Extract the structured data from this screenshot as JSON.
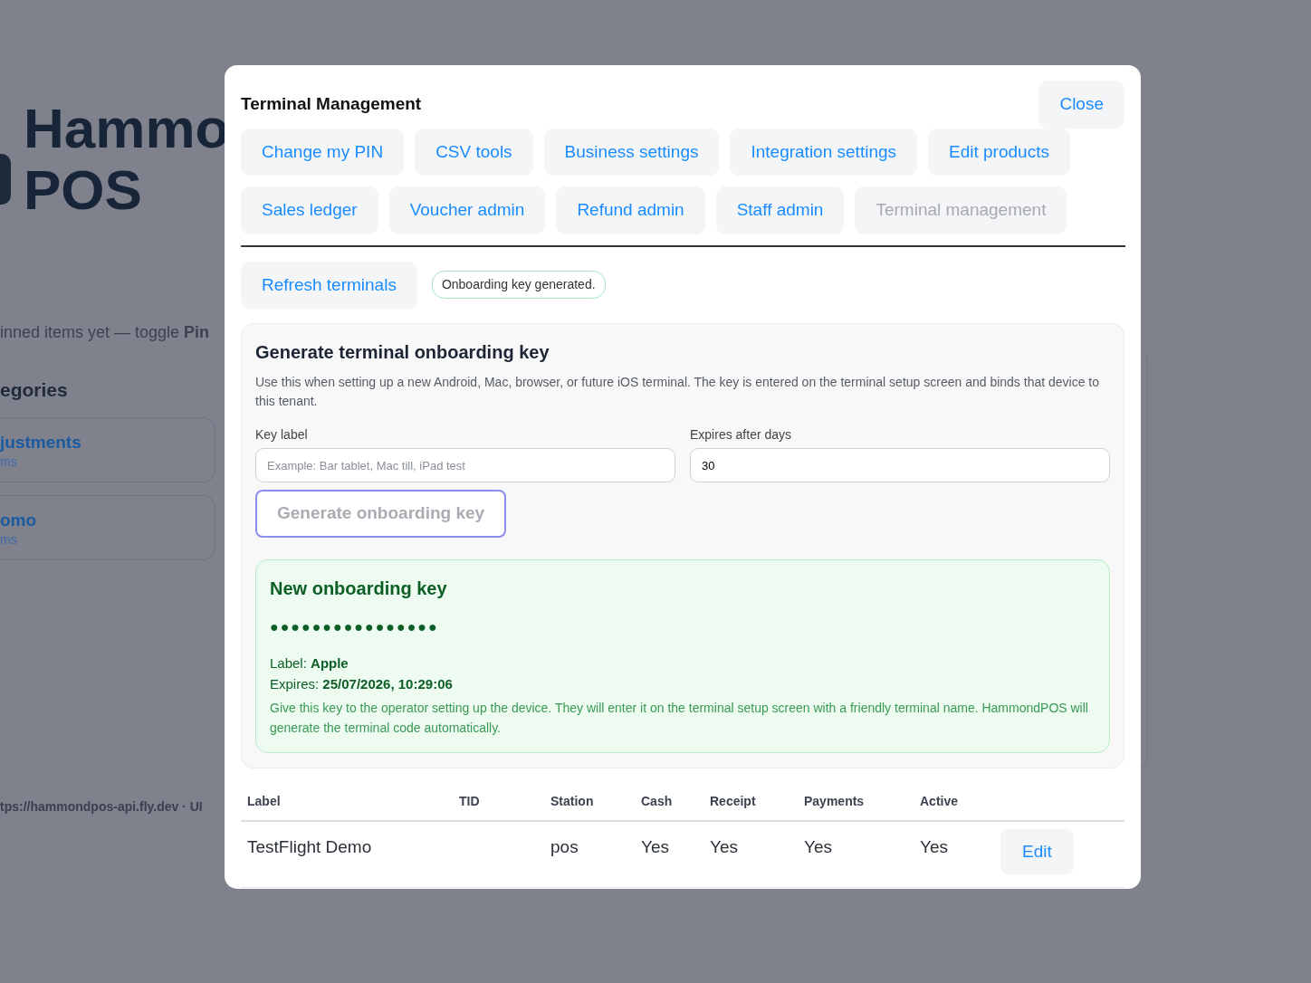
{
  "background_page": {
    "brand": {
      "line_1": "Hammo",
      "line_2": "POS"
    },
    "pinned_hint": "inned items yet — toggle **Pin**",
    "categories_heading": "egories",
    "categories": [
      {
        "name": "justments",
        "count": "ms"
      },
      {
        "name": "omo",
        "count": "ms"
      }
    ],
    "footer": "tps://hammondpos-api.fly.dev · UI"
  },
  "modal": {
    "title": "Terminal Management",
    "close_button": "Close",
    "tabs": [
      {
        "label": "Change my PIN",
        "selected": false
      },
      {
        "label": "CSV tools",
        "selected": false
      },
      {
        "label": "Business settings",
        "selected": false
      },
      {
        "label": "Integration settings",
        "selected": false
      },
      {
        "label": "Edit products",
        "selected": false
      },
      {
        "label": "Sales ledger",
        "selected": false
      },
      {
        "label": "Voucher admin",
        "selected": false
      },
      {
        "label": "Refund admin",
        "selected": false
      },
      {
        "label": "Staff admin",
        "selected": false
      },
      {
        "label": "Terminal management",
        "selected": true
      }
    ],
    "refresh_button": "Refresh terminals",
    "status_badge": "Onboarding key generated.",
    "generate_panel": {
      "title": "Generate terminal onboarding key",
      "description": "Use this when setting up a new Android, Mac, browser, or future iOS terminal. The key is entered on the terminal setup screen and binds that device to this tenant.",
      "fields": [
        {
          "label": "Key label",
          "placeholder": "Example: Bar tablet, Mac till, iPad test"
        },
        {
          "label": "Expires after days",
          "value": "30"
        }
      ],
      "generate_button": {
        "label": "Generate onboarding key",
        "disabled": true
      },
      "new_key": {
        "title": "New onboarding key",
        "masked_key": "●●●●●●●●●●●●●●●●",
        "label_line": "Label: **Apple**",
        "expires_line": "Expires: **25/07/2026, 10:29:06**",
        "note": "Give this key to the operator setting up the device. They will enter it on the terminal setup screen with a friendly terminal name. HammondPOS will generate the terminal code automatically."
      }
    },
    "table": {
      "columns": [
        "Label",
        "TID",
        "Station",
        "Cash",
        "Receipt",
        "Payments",
        "Active"
      ],
      "rows": [
        {
          "cells": [
            "TestFlight Demo",
            "",
            "pos",
            "Yes",
            "Yes",
            "Yes",
            "Yes"
          ],
          "action": "Edit"
        }
      ]
    }
  }
}
